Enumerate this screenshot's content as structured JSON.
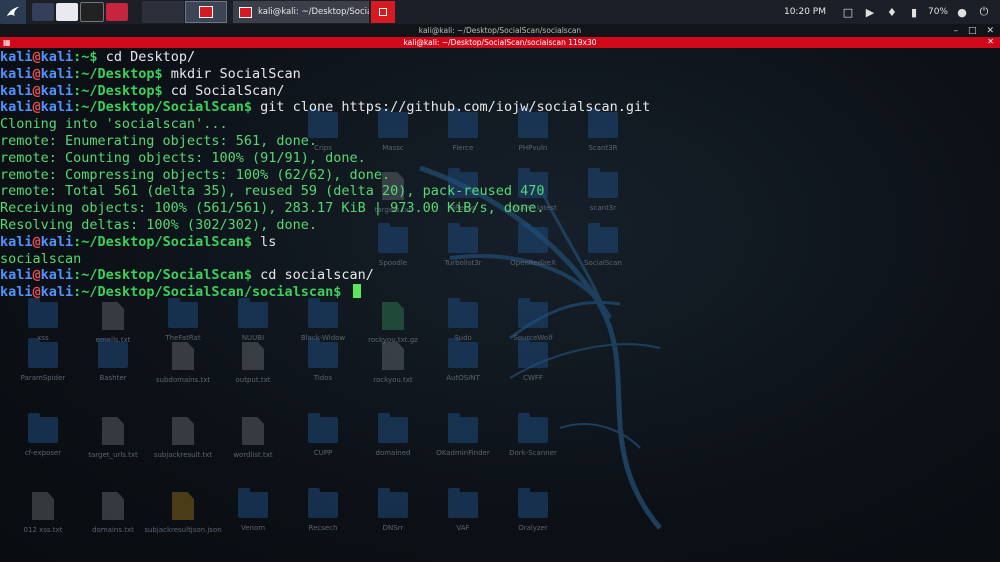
{
  "taskbar": {
    "clock": "10:20 PM",
    "battery": "70%",
    "window_title": "kali@kali: ~/Desktop/SocialScan"
  },
  "terminal": {
    "window_title": "kali@kali: ~/Desktop/SocialScan/socialscan",
    "tab_title": "kali@kali: ~/Desktop/SocialScan/socialscan 119x30",
    "user": "kali",
    "host": "kali",
    "lines": [
      {
        "type": "prompt",
        "path": "~",
        "cmd": "cd Desktop/"
      },
      {
        "type": "prompt",
        "path": "~/Desktop",
        "cmd": "mkdir SocialScan"
      },
      {
        "type": "prompt",
        "path": "~/Desktop",
        "cmd": "cd SocialScan/"
      },
      {
        "type": "prompt",
        "path": "~/Desktop/SocialScan",
        "cmd": "git clone https://github.com/iojw/socialscan.git"
      },
      {
        "type": "output",
        "text": "Cloning into 'socialscan'..."
      },
      {
        "type": "output",
        "text": "remote: Enumerating objects: 561, done."
      },
      {
        "type": "output",
        "text": "remote: Counting objects: 100% (91/91), done."
      },
      {
        "type": "output",
        "text": "remote: Compressing objects: 100% (62/62), done."
      },
      {
        "type": "output",
        "text": "remote: Total 561 (delta 35), reused 59 (delta 20), pack-reused 470"
      },
      {
        "type": "output",
        "text": "Receiving objects: 100% (561/561), 283.17 KiB | 973.00 KiB/s, done."
      },
      {
        "type": "output",
        "text": "Resolving deltas: 100% (302/302), done."
      },
      {
        "type": "prompt",
        "path": "~/Desktop/SocialScan",
        "cmd": "ls"
      },
      {
        "type": "output",
        "text": "socialscan"
      },
      {
        "type": "prompt",
        "path": "~/Desktop/SocialScan",
        "cmd": "cd socialscan/"
      },
      {
        "type": "prompt",
        "path": "~/Desktop/SocialScan/socialscan",
        "cmd": "",
        "cursor": true
      }
    ]
  },
  "desktop_icons": [
    {
      "label": "Crips",
      "kind": "folder"
    },
    {
      "label": "Massc",
      "kind": "folder"
    },
    {
      "label": "Fierce",
      "kind": "folder"
    },
    {
      "label": "PHPvuln",
      "kind": "folder"
    },
    {
      "label": "Scant3R",
      "kind": "folder"
    },
    {
      "label": "targets.txt",
      "kind": "file"
    },
    {
      "label": "GRecon",
      "kind": "folder"
    },
    {
      "label": "bWAPP_latest",
      "kind": "folder"
    },
    {
      "label": "scant3r",
      "kind": "folder"
    },
    {
      "label": "Spoodle",
      "kind": "folder"
    },
    {
      "label": "Turbolist3r",
      "kind": "folder"
    },
    {
      "label": "OpenRedireX",
      "kind": "folder"
    },
    {
      "label": "SocialScan",
      "kind": "folder"
    },
    {
      "label": "xss",
      "kind": "folder"
    },
    {
      "label": "emails.txt",
      "kind": "file"
    },
    {
      "label": "TheFatRat",
      "kind": "folder"
    },
    {
      "label": "NUUBI",
      "kind": "folder"
    },
    {
      "label": "Black-Widow",
      "kind": "folder"
    },
    {
      "label": "rockyou.txt.gz",
      "kind": "gz"
    },
    {
      "label": "Sudo",
      "kind": "folder"
    },
    {
      "label": "SourceWolf",
      "kind": "folder"
    },
    {
      "label": "ParamSpider",
      "kind": "folder"
    },
    {
      "label": "Bashter",
      "kind": "folder"
    },
    {
      "label": "subdomains.txt",
      "kind": "file"
    },
    {
      "label": "output.txt",
      "kind": "file"
    },
    {
      "label": "Tidos",
      "kind": "folder"
    },
    {
      "label": "rockyou.txt",
      "kind": "file"
    },
    {
      "label": "AutOSINT",
      "kind": "folder"
    },
    {
      "label": "CWFF",
      "kind": "folder"
    },
    {
      "label": "cf-exposer",
      "kind": "folder"
    },
    {
      "label": "target_urls.txt",
      "kind": "file"
    },
    {
      "label": "subjackresult.txt",
      "kind": "file"
    },
    {
      "label": "wordlist.txt",
      "kind": "file"
    },
    {
      "label": "CUPP",
      "kind": "folder"
    },
    {
      "label": "domained",
      "kind": "folder"
    },
    {
      "label": "OKadminFinder",
      "kind": "folder"
    },
    {
      "label": "Dork-Scanner",
      "kind": "folder"
    },
    {
      "label": "012 xss.txt",
      "kind": "file"
    },
    {
      "label": "domains.txt",
      "kind": "file"
    },
    {
      "label": "subjackresultjson.json",
      "kind": "json"
    },
    {
      "label": "Venom",
      "kind": "folder"
    },
    {
      "label": "Recsech",
      "kind": "folder"
    },
    {
      "label": "DNSrr",
      "kind": "folder"
    },
    {
      "label": "VAF",
      "kind": "folder"
    },
    {
      "label": "Oralyzer",
      "kind": "folder"
    }
  ],
  "colors": {
    "tab_accent": "#d0081a",
    "prompt_user": "#4f94ff",
    "prompt_path": "#3bd05b",
    "output_text": "#57d873"
  }
}
